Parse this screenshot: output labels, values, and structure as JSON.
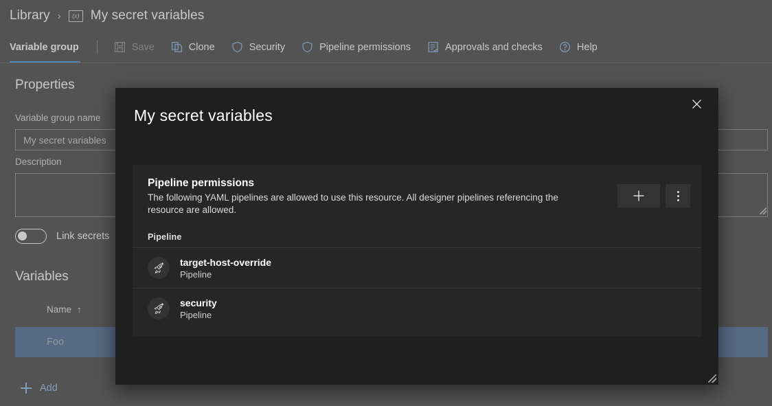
{
  "breadcrumb": {
    "root_label": "Library",
    "separator": "›",
    "icon": "variable-group-icon",
    "icon_glyph": "(x)",
    "current_label": "My secret variables"
  },
  "commandbar": {
    "active_tab": "Variable group",
    "items": [
      {
        "label": "Save",
        "icon": "save-icon",
        "disabled": true
      },
      {
        "label": "Clone",
        "icon": "clone-icon",
        "disabled": false
      },
      {
        "label": "Security",
        "icon": "shield-icon",
        "disabled": false
      },
      {
        "label": "Pipeline permissions",
        "icon": "shield-icon",
        "disabled": false
      },
      {
        "label": "Approvals and checks",
        "icon": "checklist-icon",
        "disabled": false
      },
      {
        "label": "Help",
        "icon": "help-circle-icon",
        "disabled": false
      }
    ]
  },
  "properties": {
    "section_title": "Properties",
    "name_label": "Variable group name",
    "name_value": "My secret variables",
    "description_label": "Description",
    "description_value": "",
    "link_secrets_label": "Link secrets",
    "link_secrets_on": false
  },
  "variables": {
    "section_title": "Variables",
    "column_name": "Name",
    "sort_arrow": "↑",
    "rows": [
      {
        "name": "Foo"
      }
    ],
    "add_label": "Add"
  },
  "dialog": {
    "title": "My secret variables",
    "close_icon": "close-icon",
    "resize_icon": "resize-grip-icon",
    "card": {
      "title": "Pipeline permissions",
      "description": "The following YAML pipelines are allowed to use this resource. All designer pipelines referencing the resource are allowed.",
      "add_icon": "plus-icon",
      "more_icon": "kebab-menu-icon",
      "column_header": "Pipeline",
      "items": [
        {
          "name": "target-host-override",
          "type": "Pipeline",
          "icon": "rocket-icon"
        },
        {
          "name": "security",
          "type": "Pipeline",
          "icon": "rocket-icon"
        }
      ]
    }
  },
  "colors": {
    "page_background": "#6b6b6b",
    "dialog_background": "#1f1f1f",
    "card_background": "#262626",
    "accent_blue": "#6ca9e8",
    "link_blue": "#a9c9ef",
    "selected_row": "#6f88a8"
  }
}
